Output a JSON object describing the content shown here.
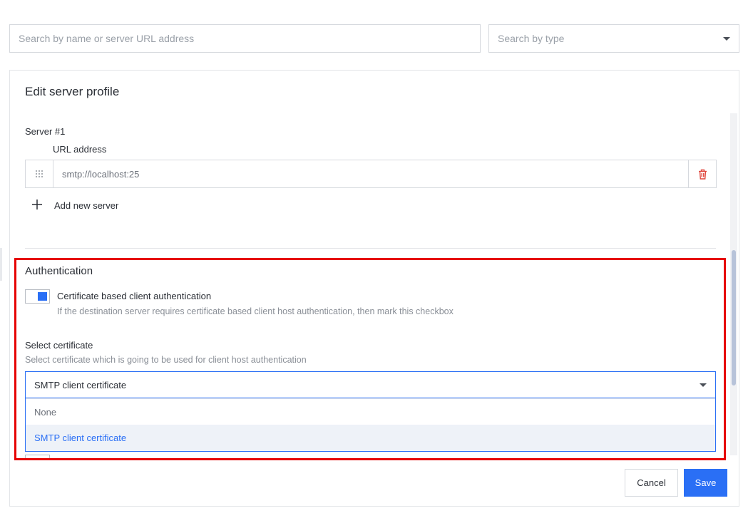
{
  "filters": {
    "search_placeholder": "Search by name or server URL address",
    "type_placeholder": "Search by type"
  },
  "panel": {
    "title": "Edit server profile"
  },
  "servers": {
    "heading": "Server #1",
    "url_label": "URL address",
    "url_value": "smtp://localhost:25",
    "add_label": "Add new server"
  },
  "authentication": {
    "title": "Authentication",
    "toggle_on": true,
    "cert_auth_label": "Certificate based client authentication",
    "cert_auth_help": "If the destination server requires certificate based client host authentication, then mark this checkbox",
    "select_label": "Select certificate",
    "select_help": "Select certificate which is going to be used for client host authentication",
    "selected_value": "SMTP client certificate",
    "options": [
      "None",
      "SMTP client certificate"
    ]
  },
  "actions": {
    "cancel_label": "Cancel",
    "save_label": "Save"
  },
  "colors": {
    "accent": "#2a6ff5",
    "delete": "#e0463c",
    "highlight": "#e60000"
  },
  "icons": {
    "drag": "drag-handle-icon",
    "delete": "trash-icon",
    "add": "plus-icon",
    "caret": "chevron-down-icon"
  }
}
